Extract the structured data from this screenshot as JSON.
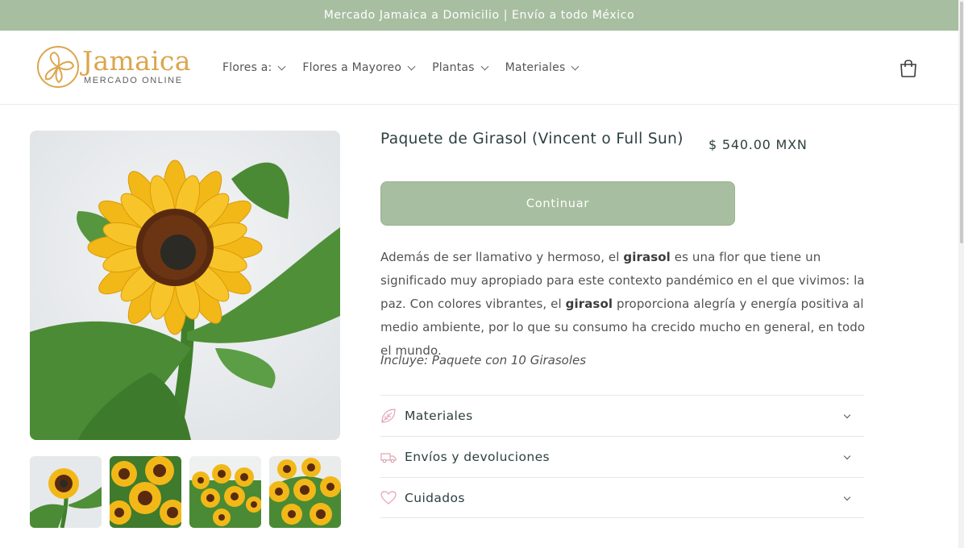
{
  "announcement": {
    "text": "Mercado Jamaica a Domicilio | Envío a todo México"
  },
  "header": {
    "logo_title": "Jamaica",
    "logo_subtitle": "MERCADO ONLINE",
    "nav": [
      {
        "label": "Flores a:"
      },
      {
        "label": "Flores a Mayoreo"
      },
      {
        "label": "Plantas"
      },
      {
        "label": "Materiales"
      }
    ],
    "cart_icon": "cart-icon"
  },
  "product": {
    "title": "Paquete de Girasol (Vincent o Full Sun)",
    "price": "$ 540.00 MXN",
    "button_label": "Continuar",
    "description": {
      "p1": " Además de ser llamativo y hermoso, el ",
      "b1": "girasol",
      "p2": " es una flor que tiene un significado muy apropiado para este contexto pandémico en el que vivimos: la paz. Con colores vibrantes, el ",
      "b2": "girasol",
      "p3": " proporciona alegría y energía positiva al medio ambiente, por lo que su consumo ha crecido mucho en general, en todo el mundo."
    },
    "includes": "Incluye: Paquete con 10 Girasoles",
    "accordion": [
      {
        "label": "Materiales",
        "icon": "leaf-icon"
      },
      {
        "label": "Envíos y devoluciones",
        "icon": "truck-icon"
      },
      {
        "label": "Cuidados",
        "icon": "heart-icon"
      }
    ]
  },
  "colors": {
    "accent": "#a8bea0",
    "logo": "#dba64d",
    "sunflower": "#f2b818",
    "heading": "#2e3f3f"
  }
}
